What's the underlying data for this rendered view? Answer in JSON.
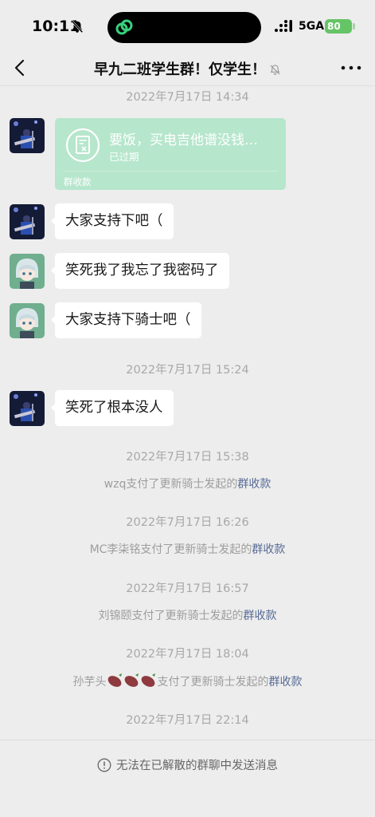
{
  "status_bar": {
    "time": "10:11",
    "network": "5GA",
    "battery": "80"
  },
  "nav": {
    "title": "早九二班学生群！仅学生！"
  },
  "messages": {
    "ts1": "2022年7月17日 14:34",
    "payment_card": {
      "title": "要饭，买电吉他谱没钱…",
      "status": "已过期",
      "footer": "群收款"
    },
    "msg1": "大家支持下吧（",
    "msg2": "笑死我了我忘了我密码了",
    "msg3": "大家支持下骑士吧（",
    "ts2": "2022年7月17日 15:24",
    "msg4": "笑死了根本没人",
    "ts3": "2022年7月17日 15:38",
    "sys1_prefix": "wzq支付了更新骑士发起的",
    "ts4": "2022年7月17日 16:26",
    "sys2_prefix": "MC李柒铭支付了更新骑士发起的",
    "ts5": "2022年7月17日 16:57",
    "sys3_prefix": "刘锦颐支付了更新骑士发起的",
    "ts6": "2022年7月17日 18:04",
    "sys4_name": "孙芋头",
    "sys4_suffix": "支付了更新骑士发起的",
    "sys_link": "群收款",
    "ts7": "2022年7月17日 22:14"
  },
  "footer": {
    "notice": "无法在已解散的群聊中发送消息"
  },
  "colors": {
    "background": "#ededed",
    "payment_card": "#b6e6cc",
    "link": "#576b95",
    "battery": "#65c466"
  },
  "icons": [
    "bell-off-icon",
    "back-chevron-icon",
    "more-dots-icon",
    "payment-receipt-icon",
    "info-circle-icon",
    "sweet-potato-emoji"
  ]
}
